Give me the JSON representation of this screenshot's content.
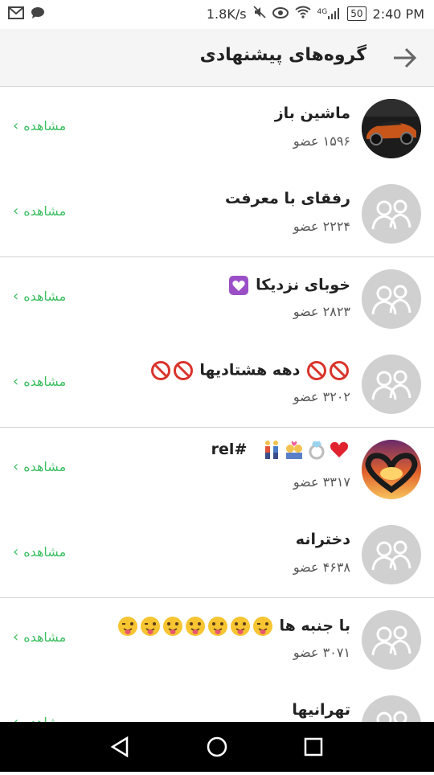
{
  "status_bar": {
    "speed": "1.8K/s",
    "network": "4G",
    "battery": "50",
    "time": "2:40 PM"
  },
  "header": {
    "title": "گروه‌های پیشنهادی"
  },
  "groups": [
    {
      "name": "ماشین باز",
      "members": "۱۵۹۶ عضو",
      "action": "مشاهده",
      "avatar": "car-photo",
      "emojis": []
    },
    {
      "name": "رفقای با معرفت",
      "members": "۲۲۲۴ عضو",
      "action": "مشاهده",
      "avatar": "default-group",
      "emojis": []
    },
    {
      "name": "خوبای نزدیکا",
      "members": "۲۸۲۳ عضو",
      "action": "مشاهده",
      "avatar": "default-group",
      "emojis": [
        "heart-box"
      ]
    },
    {
      "name": "دهه هشتادیها",
      "members": "۳۲۰۲ عضو",
      "action": "مشاهده",
      "avatar": "default-group",
      "emojis": [
        "no-sign",
        "no-sign"
      ],
      "emojis_before": [
        "no-sign",
        "no-sign"
      ]
    },
    {
      "name": "#rel",
      "members": "۳۳۱۷ عضو",
      "action": "مشاهده",
      "avatar": "heart-hands-photo",
      "emojis": [
        "red-heart",
        "ring",
        "couple-heart",
        "couple"
      ]
    },
    {
      "name": "دخترانه",
      "members": "۴۶۳۸ عضو",
      "action": "مشاهده",
      "avatar": "default-group",
      "emojis": []
    },
    {
      "name": "با جنبه ها",
      "members": "۳۰۷۱ عضو",
      "action": "مشاهده",
      "avatar": "default-group",
      "emojis": [
        "winking-tongue",
        "tongue",
        "tongue",
        "tongue",
        "tongue",
        "winking-tongue",
        "winking-tongue"
      ]
    },
    {
      "name": "تهرانیها",
      "members": "",
      "action": "مشاهده",
      "avatar": "default-group",
      "emojis": []
    }
  ],
  "colors": {
    "accent_green": "#3cbf62",
    "avatar_gray": "#d0d0d0"
  }
}
